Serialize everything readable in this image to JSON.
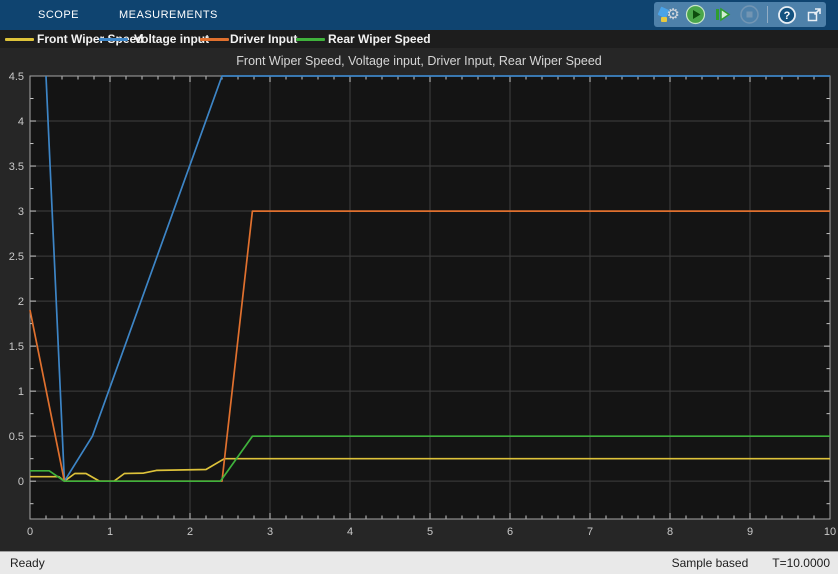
{
  "tabs": [
    {
      "label": "SCOPE"
    },
    {
      "label": "MEASUREMENTS"
    }
  ],
  "toolbar": {
    "help_glyph": "?",
    "icons": [
      {
        "name": "settings",
        "disabled": false
      },
      {
        "name": "run",
        "disabled": false
      },
      {
        "name": "step-forward",
        "disabled": false
      },
      {
        "name": "stop",
        "disabled": true
      },
      {
        "name": "help",
        "disabled": false
      },
      {
        "name": "dock",
        "disabled": false
      }
    ]
  },
  "legend": {
    "items": [
      {
        "label": "Front Wiper Speed",
        "color": "#ddc23a"
      },
      {
        "label": "Voltage input",
        "color": "#3d85c6"
      },
      {
        "label": "Driver Input",
        "color": "#e0702e"
      },
      {
        "label": "Rear Wiper Speed",
        "color": "#3fb23c"
      }
    ]
  },
  "status_bar": {
    "left": "Ready",
    "center": "Sample based",
    "right": "T=10.0000"
  },
  "colors": {
    "titlebar": "#0f4470",
    "toolbar_panel": "#4e81aa",
    "panel_bg": "#262626",
    "legend_bg": "#1d1d1d",
    "plot_bg": "#141414",
    "grid": "#3f3f3f",
    "axis_border": "#a6a6a6",
    "tick": "#c8c8c8",
    "tick_label": "#c9c9c9",
    "status_bg": "#e9e9e9"
  },
  "chart_data": {
    "type": "line",
    "title": "Front Wiper Speed, Voltage input, Driver Input, Rear Wiper Speed",
    "xlabel": "",
    "ylabel": "",
    "xlim": [
      0,
      10
    ],
    "ylim": [
      -0.42,
      4.5
    ],
    "xticks": [
      0,
      1,
      2,
      3,
      4,
      5,
      6,
      7,
      8,
      9,
      10
    ],
    "xtick_labels": [
      "0",
      "1",
      "2",
      "3",
      "4",
      "5",
      "6",
      "7",
      "8",
      "9",
      "10"
    ],
    "yticks": [
      0,
      0.5,
      1,
      1.5,
      2,
      2.5,
      3,
      3.5,
      4,
      4.5
    ],
    "ytick_labels": [
      "0",
      "0.5",
      "1",
      "1.5",
      "2",
      "2.5",
      "3",
      "3.5",
      "4",
      "4.5"
    ],
    "x_minor_step": 0.2,
    "y_minor_step": 0.25,
    "grid": true,
    "legend_position": "top-strip",
    "series": [
      {
        "name": "Front Wiper Speed",
        "color": "#ddc23a",
        "points": [
          [
            0,
            0.05
          ],
          [
            0.36,
            0.05
          ],
          [
            0.43,
            0
          ],
          [
            0.56,
            0.085
          ],
          [
            0.7,
            0.085
          ],
          [
            0.87,
            0
          ],
          [
            1.05,
            0
          ],
          [
            1.18,
            0.085
          ],
          [
            1.42,
            0.09
          ],
          [
            1.58,
            0.12
          ],
          [
            2.2,
            0.13
          ],
          [
            2.43,
            0.25
          ],
          [
            10,
            0.25
          ]
        ]
      },
      {
        "name": "Voltage input",
        "color": "#3d85c6",
        "points": [
          [
            0.2,
            4.5
          ],
          [
            0.43,
            0
          ],
          [
            0.78,
            0.5
          ],
          [
            2.4,
            4.5
          ],
          [
            10,
            4.5
          ]
        ]
      },
      {
        "name": "Driver Input",
        "color": "#e0702e",
        "points": [
          [
            0,
            1.9
          ],
          [
            0.43,
            0
          ],
          [
            2.4,
            0
          ],
          [
            2.78,
            3.0
          ],
          [
            10,
            3.0
          ]
        ]
      },
      {
        "name": "Rear Wiper Speed",
        "color": "#3fb23c",
        "points": [
          [
            0,
            0.115
          ],
          [
            0.24,
            0.115
          ],
          [
            0.43,
            0
          ],
          [
            2.38,
            0
          ],
          [
            2.78,
            0.5
          ],
          [
            10,
            0.5
          ]
        ]
      }
    ]
  }
}
